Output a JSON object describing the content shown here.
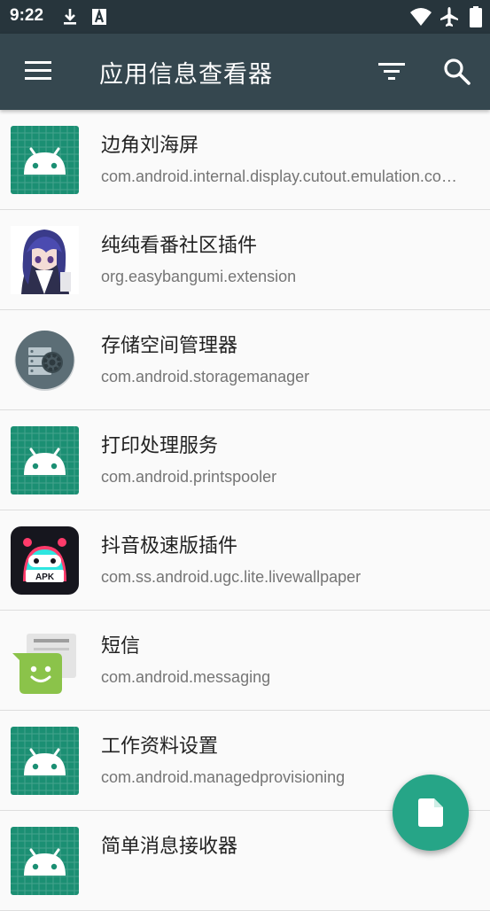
{
  "status_bar": {
    "time": "9:22",
    "left_icons": [
      "download-icon",
      "a-notification-icon"
    ],
    "right_icons": [
      "wifi-icon",
      "airplane-icon",
      "battery-icon"
    ]
  },
  "app_bar": {
    "title": "应用信息查看器",
    "icons": [
      "menu-icon",
      "filter-icon",
      "search-icon"
    ]
  },
  "apps": [
    {
      "name": "边角刘海屏",
      "package": "com.android.internal.display.cutout.emulation.corner",
      "icon": "android-icon"
    },
    {
      "name": "纯纯看番社区插件",
      "package": "org.easybangumi.extension",
      "icon": "anime-avatar-icon"
    },
    {
      "name": "存储空间管理器",
      "package": "com.android.storagemanager",
      "icon": "storage-gear-icon"
    },
    {
      "name": "打印处理服务",
      "package": "com.android.printspooler",
      "icon": "android-icon"
    },
    {
      "name": "抖音极速版插件",
      "package": "com.ss.android.ugc.lite.livewallpaper",
      "icon": "apk-robot-icon",
      "icon_text": "APK"
    },
    {
      "name": "短信",
      "package": "com.android.messaging",
      "icon": "messaging-icon"
    },
    {
      "name": "工作资料设置",
      "package": "com.android.managedprovisioning",
      "icon": "android-icon"
    },
    {
      "name": "简单消息接收器",
      "package": "",
      "icon": "android-icon"
    }
  ],
  "fab": {
    "icon": "document-icon"
  },
  "colors": {
    "status_bar": "#27353c",
    "app_bar": "#35474f",
    "accent": "#26a587",
    "android_icon_bg": "#1b8f73"
  }
}
